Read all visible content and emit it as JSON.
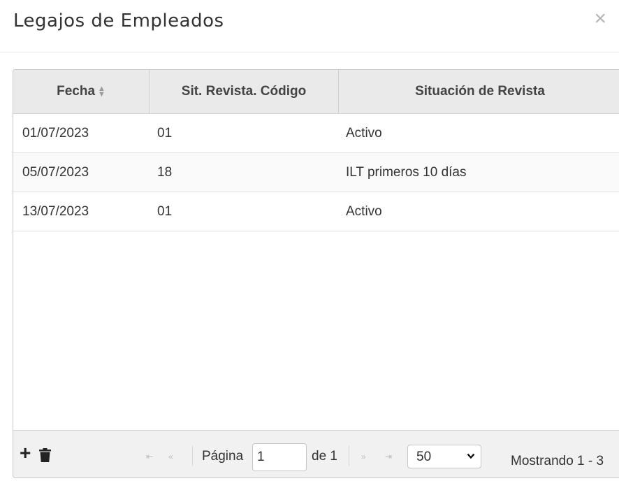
{
  "dialog": {
    "title": "Legajos de Empleados",
    "close_label": "×"
  },
  "table": {
    "columns": [
      "Fecha",
      "Sit. Revista. Código",
      "Situación de Revista"
    ],
    "rows": [
      [
        "01/07/2023",
        "01",
        "Activo"
      ],
      [
        "05/07/2023",
        "18",
        "ILT primeros 10 días"
      ],
      [
        "13/07/2023",
        "01",
        "Activo"
      ]
    ]
  },
  "footer": {
    "add_icon": "plus-icon",
    "delete_icon": "trash-icon",
    "page_label": "Página",
    "page_value": "1",
    "of_label": "de 1",
    "page_size": "50",
    "status_text": "Mostrando 1 - 3"
  }
}
